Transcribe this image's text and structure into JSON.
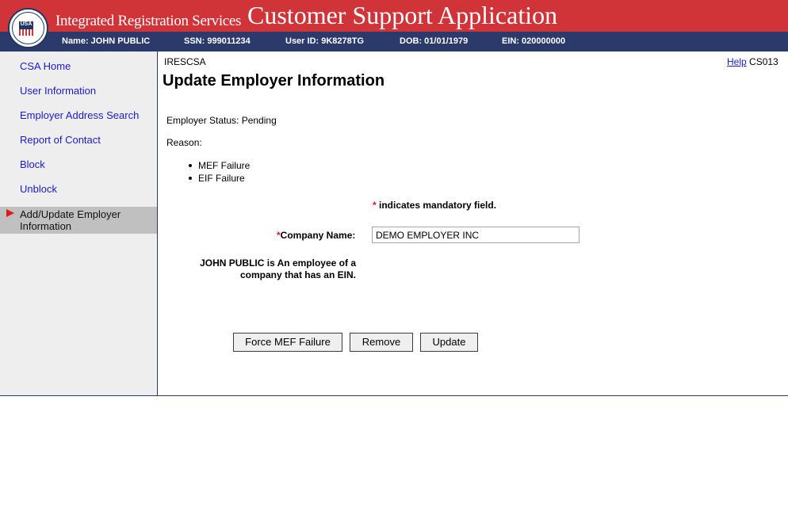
{
  "header": {
    "subtitle": "Integrated Registration Services",
    "title": "Customer Support Application"
  },
  "infobar": {
    "name": "Name: JOHN PUBLIC",
    "ssn": "SSN: 999011234",
    "user_id": "User ID: 9K8278TG",
    "dob": "DOB: 01/01/1979",
    "ein": "EIN: 020000000"
  },
  "sidebar": {
    "items": [
      {
        "label": "CSA Home"
      },
      {
        "label": "User Information"
      },
      {
        "label": "Employer Address Search"
      },
      {
        "label": "Report of Contact"
      },
      {
        "label": "Block"
      },
      {
        "label": "Unblock"
      }
    ],
    "active_item": "Add/Update Employer Information"
  },
  "main": {
    "app_code": "IRESCSA",
    "help_label": "Help",
    "screen_code": "CS013",
    "page_title": "Update Employer Information",
    "employer_status": "Employer Status: Pending",
    "reason_label": "Reason:",
    "reasons": [
      "MEF Failure",
      "EIF Failure"
    ],
    "mandatory_star": "*",
    "mandatory_note": " indicates mandatory field.",
    "company_name_label": "Company Name:",
    "company_name_value": "DEMO EMPLOYER INC",
    "employee_note": "JOHN PUBLIC is An employee of a company that has an EIN.",
    "buttons": {
      "force_mef": "Force MEF Failure",
      "remove": "Remove",
      "update": "Update"
    }
  },
  "colors": {
    "header_red": "#d13438",
    "infobar_navy": "#2b3a6b",
    "link_blue": "#1a1acc",
    "active_bg": "#c0c0c0"
  },
  "logo": {
    "text": "USA"
  }
}
